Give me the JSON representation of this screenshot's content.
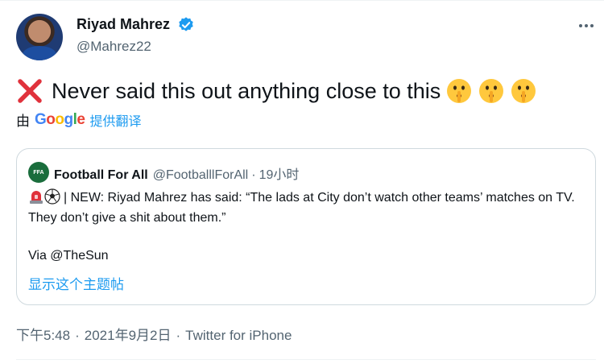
{
  "author": {
    "name": "Riyad Mahrez",
    "handle": "@Mahrez22",
    "verified": true
  },
  "tweet": {
    "text": "Never said this out anything close to this",
    "leading_icon": "red-cross-mark",
    "trailing_icons": [
      "shushing-face",
      "shushing-face",
      "shushing-face"
    ]
  },
  "translate": {
    "prefix": "由",
    "provider": [
      "G",
      "o",
      "o",
      "g",
      "l",
      "e"
    ],
    "link_label": "提供翻译"
  },
  "quote": {
    "author_name": "Football For All",
    "author_handle": "@FootballlForAll",
    "separator": "·",
    "time": "19小时",
    "avatar_text": "FFA",
    "body": "| NEW: Riyad Mahrez  has said: “The lads at City don’t watch other teams’ matches on TV. They don’t give a shit about them.”",
    "body_icons": [
      "police-siren",
      "soccer-ball"
    ],
    "via": "Via @TheSun",
    "show_thread_label": "显示这个主题帖"
  },
  "meta": {
    "time": "下午5:48",
    "separator": "·",
    "date": "2021年9月2日",
    "client": "Twitter for iPhone"
  },
  "colors": {
    "accent": "#1d9bf0",
    "text": "#0f1419",
    "secondary": "#536471",
    "border": "#cfd9de"
  }
}
